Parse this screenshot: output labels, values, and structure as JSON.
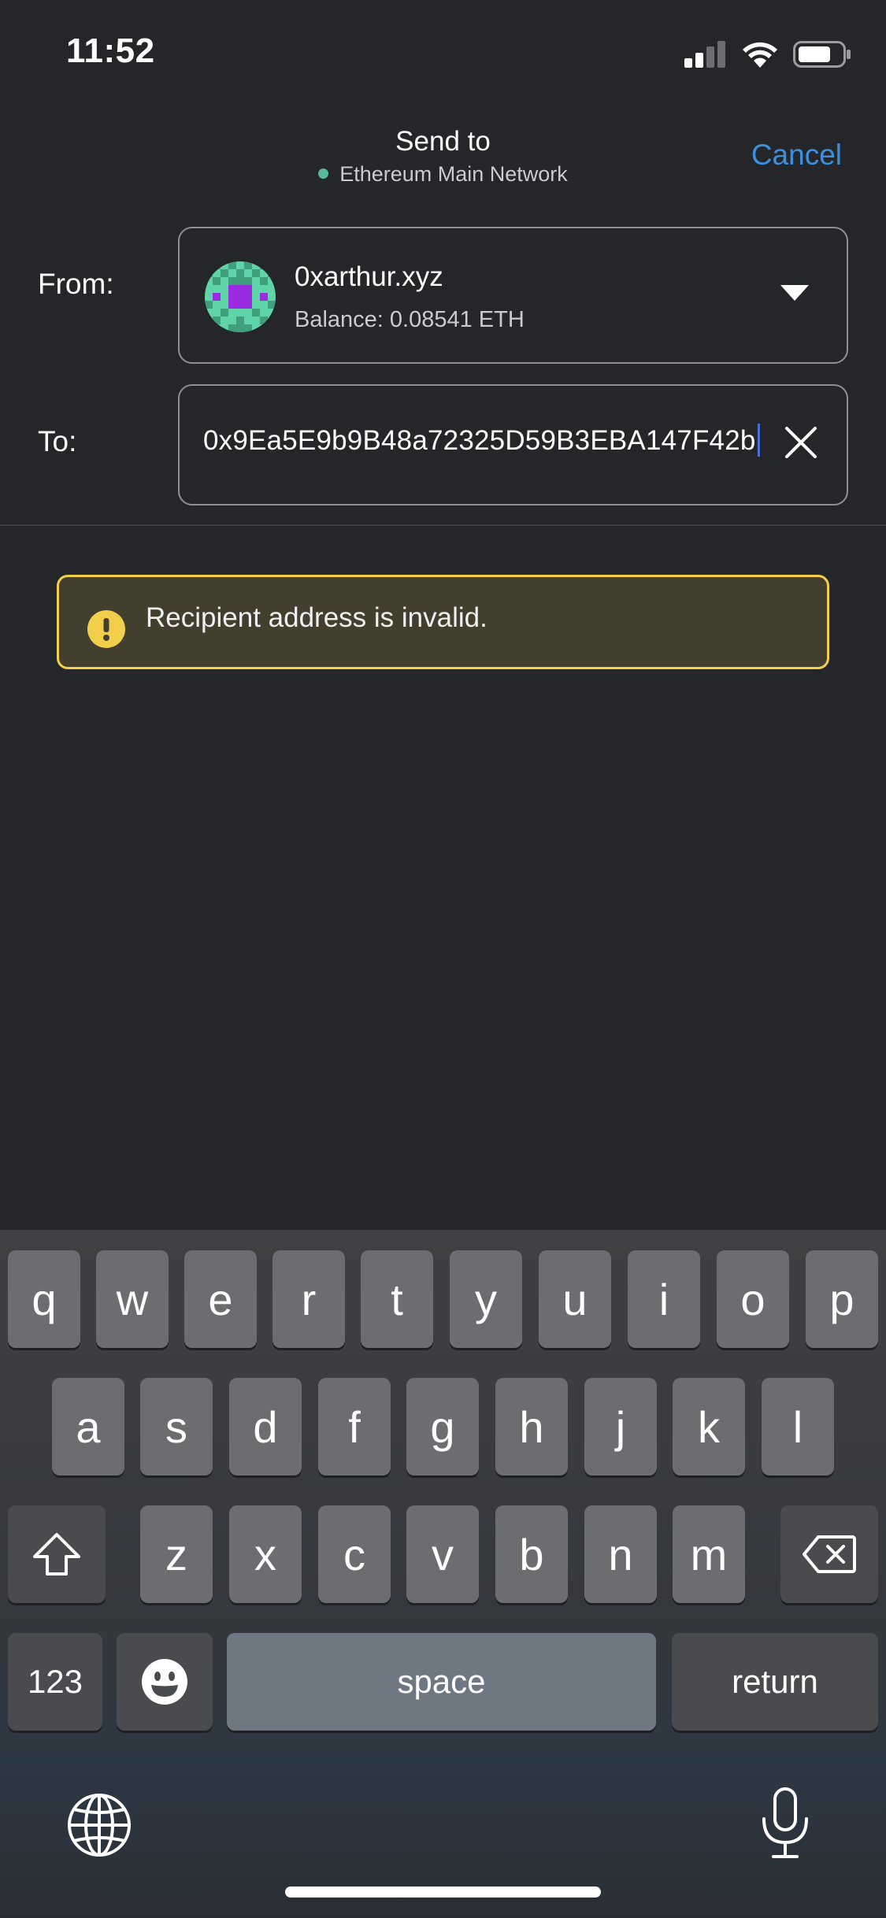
{
  "status_bar": {
    "time": "11:52"
  },
  "header": {
    "title": "Send to",
    "network": "Ethereum Main Network",
    "cancel_label": "Cancel"
  },
  "from": {
    "label": "From:",
    "account_name": "0xarthur.xyz",
    "balance": "Balance: 0.08541 ETH"
  },
  "to": {
    "label": "To:",
    "value": "0x9Ea5E9b9B48a72325D59B3EBA147F42b"
  },
  "warning": {
    "message": "Recipient address is invalid."
  },
  "keyboard": {
    "row1": [
      "q",
      "w",
      "e",
      "r",
      "t",
      "y",
      "u",
      "i",
      "o",
      "p"
    ],
    "row2": [
      "a",
      "s",
      "d",
      "f",
      "g",
      "h",
      "j",
      "k",
      "l"
    ],
    "row3": [
      "z",
      "x",
      "c",
      "v",
      "b",
      "n",
      "m"
    ],
    "numbers_label": "123",
    "space_label": "space",
    "return_label": "return"
  },
  "colors": {
    "background": "#24262a",
    "accent": "#3d8fe0",
    "network_dot": "#59b99a",
    "warning_border": "#f1cf4b",
    "warning_bg": "#433f2f"
  }
}
